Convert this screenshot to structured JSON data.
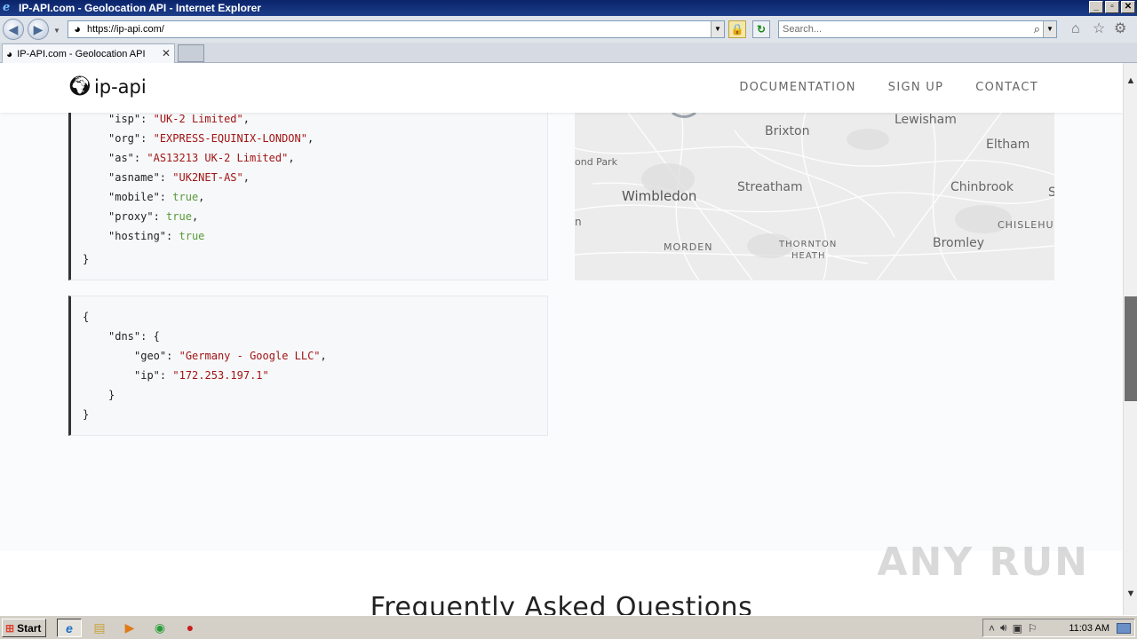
{
  "window": {
    "title": "IP-API.com - Geolocation API - Internet Explorer",
    "controls": [
      "_",
      "▫",
      "✕"
    ]
  },
  "toolbar": {
    "url": "https://ip-api.com/",
    "search_placeholder": "Search..."
  },
  "tabs": [
    {
      "label": "IP-API.com - Geolocation API",
      "close": "✕"
    }
  ],
  "site": {
    "brand": "ip-api",
    "nav": [
      "DOCUMENTATION",
      "SIGN UP",
      "CONTACT"
    ]
  },
  "json_response_tail": {
    "lines": [
      {
        "key": "\"isp\"",
        "value": "\"UK-2 Limited\"",
        "type": "string",
        "comma": ","
      },
      {
        "key": "\"org\"",
        "value": "\"EXPRESS-EQUINIX-LONDON\"",
        "type": "string",
        "comma": ","
      },
      {
        "key": "\"as\"",
        "value": "\"AS13213 UK-2 Limited\"",
        "type": "string",
        "comma": ","
      },
      {
        "key": "\"asname\"",
        "value": "\"UK2NET-AS\"",
        "type": "string",
        "comma": ","
      },
      {
        "key": "\"mobile\"",
        "value": "true",
        "type": "bool",
        "comma": ","
      },
      {
        "key": "\"proxy\"",
        "value": "true",
        "type": "bool",
        "comma": ","
      },
      {
        "key": "\"hosting\"",
        "value": "true",
        "type": "bool",
        "comma": ""
      }
    ],
    "close": "}"
  },
  "dns_response": {
    "open": "{",
    "dns_key": "\"dns\"",
    "dns_open": "{",
    "geo_key": "\"geo\"",
    "geo_value": "\"Germany - Google LLC\"",
    "ip_key": "\"ip\"",
    "ip_value": "\"172.253.197.1\"",
    "inner_close": "}",
    "close": "}",
    "colon": ":",
    "comma": ","
  },
  "map": {
    "labels": [
      "Lewisham",
      "Brixton",
      "Eltham",
      "ond Park",
      "Wimbledon",
      "Streatham",
      "Chinbrook",
      "S",
      "n",
      "CHISLEHU",
      "MORDEN",
      "THORNTON",
      "HEATH",
      "Bromley"
    ]
  },
  "faq": {
    "title": "Frequently Asked Questions"
  },
  "watermark": "ANY RUN",
  "taskbar": {
    "start": "Start",
    "clock": "11:03 AM"
  },
  "colors": {
    "string": "#a31515",
    "bool": "#5a9a3a",
    "accent_border": "#333333"
  }
}
